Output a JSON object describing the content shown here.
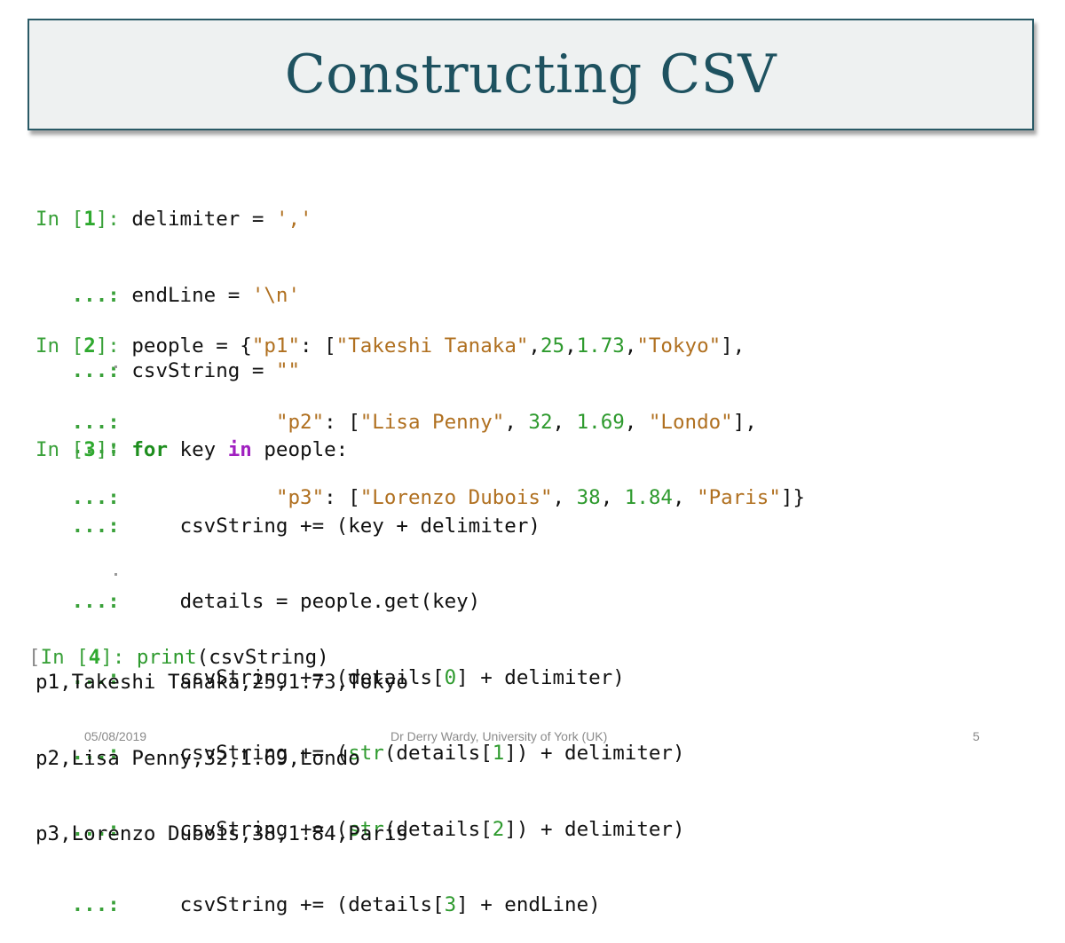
{
  "slide": {
    "title": "Constructing CSV"
  },
  "cells": {
    "c1": {
      "prompt_in": "In [",
      "prompt_num": "1",
      "prompt_close": "]: ",
      "cont": "   ...: ",
      "line1_code": "delimiter = ",
      "line1_str": "','",
      "line2_code": "endLine = ",
      "line2_str": "'\\n'",
      "line3_code": "csvString = ",
      "line3_str": "\"\"",
      "line4_cont": "   ...:"
    },
    "c2": {
      "prompt_num": "2",
      "l1_a": "people = {",
      "l1_key": "\"p1\"",
      "l1_b": ": [",
      "l1_s1": "\"Takeshi Tanaka\"",
      "l1_c1": ",",
      "l1_n1": "25",
      "l1_c2": ",",
      "l1_n2": "1.73",
      "l1_c3": ",",
      "l1_s2": "\"Tokyo\"",
      "l1_end": "],",
      "l2_pad": "            ",
      "l2_key": "\"p2\"",
      "l2_b": ": [",
      "l2_s1": "\"Lisa Penny\"",
      "l2_c1": ", ",
      "l2_n1": "32",
      "l2_c2": ", ",
      "l2_n2": "1.69",
      "l2_c3": ", ",
      "l2_s2": "\"Londo\"",
      "l2_end": "],",
      "l3_key": "\"p3\"",
      "l3_b": ": [",
      "l3_s1": "\"Lorenzo Dubois\"",
      "l3_c1": ", ",
      "l3_n1": "38",
      "l3_c2": ", ",
      "l3_n2": "1.84",
      "l3_c3": ", ",
      "l3_s2": "\"Paris\"",
      "l3_end": "]}"
    },
    "c3": {
      "prompt_num": "3",
      "for_kw": "for",
      "for_mid": " key ",
      "in_kw": "in",
      "for_end": " people:",
      "indent": "    ",
      "b1": "csvString += (key + delimiter)",
      "b2": "details = people.get(key)",
      "b3a": "csvString += (details[",
      "b3n": "0",
      "b3b": "] + delimiter)",
      "b4a": "csvString += (",
      "b4f": "str",
      "b4b": "(details[",
      "b4n": "1",
      "b4c": "]) + delimiter)",
      "b5a": "csvString += (",
      "b5f": "str",
      "b5b": "(details[",
      "b5n": "2",
      "b5c": "]) + delimiter)",
      "b6a": "csvString += (details[",
      "b6n": "3",
      "b6b": "] + endLine)"
    },
    "c4": {
      "bracket": "[",
      "prompt_in": "In [",
      "prompt_num": "4",
      "prompt_close": "]: ",
      "call_fn": "print",
      "call_arg": "(csvString)",
      "out1": "p1,Takeshi Tanaka,25,1.73,Tokyo",
      "out2": "p2,Lisa Penny,32,1.69,Londo",
      "out3": "p3,Lorenzo Dubois,38,1.84,Paris"
    }
  },
  "footer": {
    "date": "05/08/2019",
    "author": "Dr Derry Wardy, University of York (UK)",
    "page": "5"
  }
}
